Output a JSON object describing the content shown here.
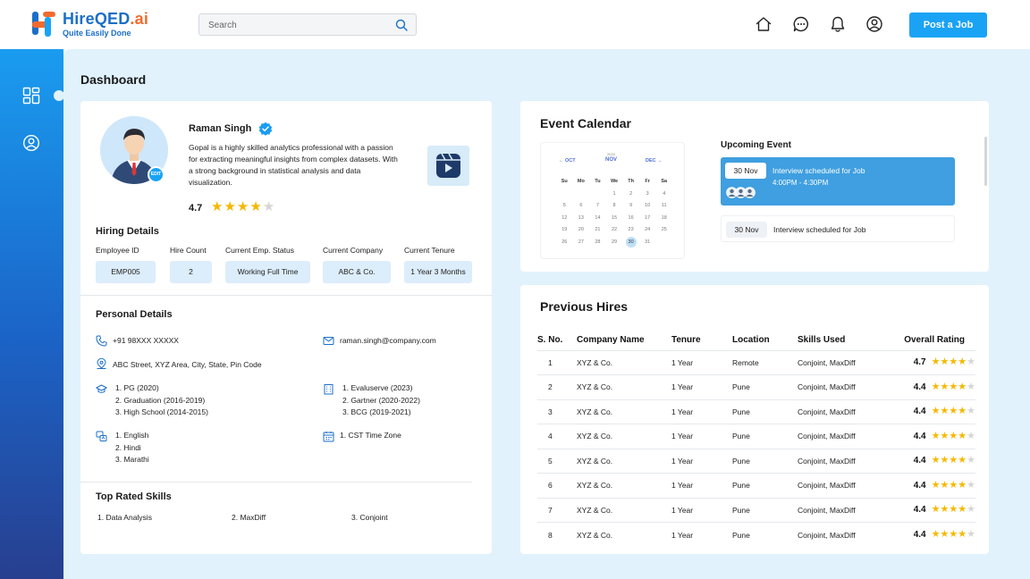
{
  "brand": {
    "name": "HireQED",
    "ai": ".ai",
    "tagline": "Quite Easily Done"
  },
  "search": {
    "placeholder": "Search"
  },
  "header": {
    "post_job_label": "Post a Job"
  },
  "colors": {
    "accent": "#1aa3f5",
    "star": "#f5b800",
    "star_empty": "#d6d6d6",
    "event_bg": "#3f9fe0",
    "sidebar_top": "#1a9cf0",
    "sidebar_bottom": "#283f8f",
    "page_bg": "#e1f2fc"
  },
  "page": {
    "title": "Dashboard"
  },
  "profile": {
    "name": "Raman Singh",
    "bio": "Gopal is a highly skilled analytics professional with a passion for extracting meaningful insights from complex datasets. With a strong background in statistical analysis and data visualization.",
    "rating": "4.7",
    "rating_value": 4,
    "edit_badge": "EDIT"
  },
  "hiring": {
    "title": "Hiring Details",
    "fields": [
      {
        "label": "Employee ID",
        "value": "EMP005"
      },
      {
        "label": "Hire Count",
        "value": "2"
      },
      {
        "label": "Current Emp. Status",
        "value": "Working Full Time"
      },
      {
        "label": "Current Company",
        "value": "ABC & Co."
      },
      {
        "label": "Current Tenure",
        "value": "1 Year 3 Months"
      }
    ]
  },
  "personal": {
    "title": "Personal Details",
    "phone": "+91 98XXX XXXXX",
    "email": "raman.singh@company.com",
    "address": "ABC Street, XYZ Area, City, State, Pin Code",
    "education": [
      "1. PG (2020)",
      "2. Graduation (2016-2019)",
      "3. High School (2014-2015)"
    ],
    "experience": [
      "1. Evaluserve (2023)",
      "2. Gartner (2020-2022)",
      "3. BCG (2019-2021)"
    ],
    "languages": [
      "1. English",
      "2. Hindi",
      "3. Marathi"
    ],
    "timezone": "1. CST Time Zone"
  },
  "skills": {
    "title": "Top Rated Skills",
    "items": [
      "1.  Data Analysis",
      "2.  MaxDiff",
      "3.  Conjoint"
    ]
  },
  "calendar": {
    "title": "Event Calendar",
    "prev": "OCT",
    "current": "NOV",
    "next": "DEC",
    "year": "2023",
    "weekdays": [
      "Su",
      "Mo",
      "Tu",
      "We",
      "Th",
      "Fr",
      "Sa"
    ],
    "weeks": [
      [
        "",
        "",
        "",
        "1",
        "2",
        "3",
        "4"
      ],
      [
        "5",
        "6",
        "7",
        "8",
        "9",
        "10",
        "11"
      ],
      [
        "12",
        "13",
        "14",
        "15",
        "16",
        "17",
        "18"
      ],
      [
        "19",
        "20",
        "21",
        "22",
        "23",
        "24",
        "25"
      ],
      [
        "26",
        "27",
        "28",
        "29",
        "30",
        "31",
        ""
      ]
    ],
    "selected": "30",
    "upcoming_title": "Upcoming Event",
    "events": [
      {
        "date": "30 Nov",
        "text": "Interview scheduled for Job",
        "time": "4:00PM - 4:30PM"
      },
      {
        "date": "30 Nov",
        "text": "Interview scheduled for Job"
      }
    ]
  },
  "hires": {
    "title": "Previous Hires",
    "columns": [
      "S. No.",
      "Company Name",
      "Tenure",
      "Location",
      "Skills Used",
      "Overall Rating"
    ],
    "rows": [
      {
        "sno": "1",
        "company": "XYZ & Co.",
        "tenure": "1 Year",
        "location": "Remote",
        "skills": "Conjoint, MaxDiff",
        "rating": "4.7",
        "stars": 4
      },
      {
        "sno": "2",
        "company": "XYZ & Co.",
        "tenure": "1 Year",
        "location": "Pune",
        "skills": "Conjoint, MaxDiff",
        "rating": "4.4",
        "stars": 4
      },
      {
        "sno": "3",
        "company": "XYZ & Co.",
        "tenure": "1 Year",
        "location": "Pune",
        "skills": "Conjoint, MaxDiff",
        "rating": "4.4",
        "stars": 4
      },
      {
        "sno": "4",
        "company": "XYZ & Co.",
        "tenure": "1 Year",
        "location": "Pune",
        "skills": "Conjoint, MaxDiff",
        "rating": "4.4",
        "stars": 4
      },
      {
        "sno": "5",
        "company": "XYZ & Co.",
        "tenure": "1 Year",
        "location": "Pune",
        "skills": "Conjoint, MaxDiff",
        "rating": "4.4",
        "stars": 4
      },
      {
        "sno": "6",
        "company": "XYZ & Co.",
        "tenure": "1 Year",
        "location": "Pune",
        "skills": "Conjoint, MaxDiff",
        "rating": "4.4",
        "stars": 4
      },
      {
        "sno": "7",
        "company": "XYZ & Co.",
        "tenure": "1 Year",
        "location": "Pune",
        "skills": "Conjoint, MaxDiff",
        "rating": "4.4",
        "stars": 4
      },
      {
        "sno": "8",
        "company": "XYZ & Co.",
        "tenure": "1 Year",
        "location": "Pune",
        "skills": "Conjoint, MaxDiff",
        "rating": "4.4",
        "stars": 4
      }
    ]
  }
}
